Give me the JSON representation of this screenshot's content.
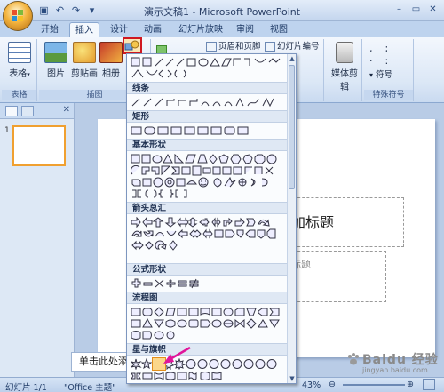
{
  "titlebar": {
    "title": "演示文稿1 - Microsoft PowerPoint",
    "qat_icons": [
      "save-icon",
      "undo-icon",
      "redo-icon",
      "customize-icon"
    ],
    "window_buttons": [
      "minimize-icon",
      "maximize-icon",
      "close-icon"
    ]
  },
  "tabs": [
    {
      "label": "开始"
    },
    {
      "label": "插入",
      "active": true
    },
    {
      "label": "设计"
    },
    {
      "label": "动画"
    },
    {
      "label": "幻灯片放映"
    },
    {
      "label": "审阅"
    },
    {
      "label": "视图"
    }
  ],
  "ribbon": {
    "table_button": "表格",
    "table_group": "表格",
    "picture_button": "图片",
    "clipart_button": "剪贴画",
    "album_button": "相册",
    "illustration_group": "插图",
    "header_footer": "页眉和页脚",
    "slide_number": "幻灯片编号",
    "media_button": "媒体剪辑",
    "symbol_button": "符号",
    "special_symbols_group": "特殊符号"
  },
  "shapes_menu": {
    "sections": [
      "线条",
      "矩形",
      "基本形状",
      "箭头总汇",
      "公式形状",
      "流程图",
      "星与旗帜"
    ]
  },
  "slide": {
    "title_placeholder": "加标题",
    "subtitle_placeholder": "标题"
  },
  "notes": {
    "text": "单击此处添"
  },
  "statusbar": {
    "slide_info": "幻灯片 1/1",
    "theme": "\"Office 主题\"",
    "zoom": "43%"
  },
  "watermark": {
    "text": "Baidu 经验",
    "url": "jingyan.baidu.com"
  },
  "colors": {
    "ribbon_blue": "#dbe7f6",
    "highlight_red": "#d01820",
    "selection_orange": "#e28d1a",
    "arrow_pink": "#e0159a"
  }
}
